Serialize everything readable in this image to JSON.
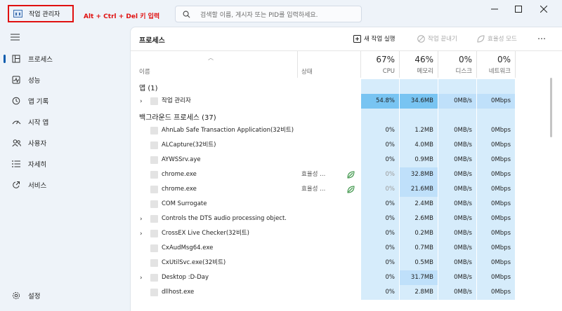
{
  "app": {
    "title": "작업 관리자",
    "annotation": "Alt + Ctrl + Del 키 입력",
    "search_placeholder": "검색할 이름, 게시자 또는 PID를 입력하세요."
  },
  "sidebar": {
    "items": [
      {
        "label": "프로세스",
        "icon": "processes-icon"
      },
      {
        "label": "성능",
        "icon": "performance-icon"
      },
      {
        "label": "앱 기록",
        "icon": "app-history-icon"
      },
      {
        "label": "시작 앱",
        "icon": "startup-apps-icon"
      },
      {
        "label": "사용자",
        "icon": "users-icon"
      },
      {
        "label": "자세히",
        "icon": "details-icon"
      },
      {
        "label": "서비스",
        "icon": "services-icon"
      }
    ],
    "settings_label": "설정"
  },
  "main": {
    "title": "프로세스",
    "commands": {
      "new_task": "새 작업 실행",
      "end_task": "작업 끝내기",
      "efficiency": "효율성 모드"
    },
    "columns": {
      "name": "이름",
      "status": "상태",
      "cpu": {
        "pct": "67%",
        "label": "CPU"
      },
      "mem": {
        "pct": "46%",
        "label": "메모리"
      },
      "disk": {
        "pct": "0%",
        "label": "디스크"
      },
      "net": {
        "pct": "0%",
        "label": "네트워크"
      }
    },
    "groups": {
      "apps": "앱 (1)",
      "background": "백그라운드 프로세스 (37)"
    },
    "app_rows": [
      {
        "name": "작업 관리자",
        "status": "",
        "cpu": "54.8%",
        "mem": "34.6MB",
        "disk": "0MB/s",
        "net": "0Mbps",
        "expand": true
      }
    ],
    "bg_rows": [
      {
        "name": "AhnLab Safe Transaction Application(32비트)",
        "status": "",
        "cpu": "0%",
        "mem": "1.2MB",
        "disk": "0MB/s",
        "net": "0Mbps",
        "expand": false
      },
      {
        "name": "ALCapture(32비트)",
        "status": "",
        "cpu": "0%",
        "mem": "4.0MB",
        "disk": "0MB/s",
        "net": "0Mbps",
        "expand": false
      },
      {
        "name": "AYWSSrv.aye",
        "status": "",
        "cpu": "0%",
        "mem": "0.9MB",
        "disk": "0MB/s",
        "net": "0Mbps",
        "expand": false
      },
      {
        "name": "chrome.exe",
        "status": "효율성 ...",
        "cpu": "0%",
        "mem": "32.8MB",
        "disk": "0MB/s",
        "net": "0Mbps",
        "expand": false,
        "efficiency": true
      },
      {
        "name": "chrome.exe",
        "status": "효율성 ...",
        "cpu": "0%",
        "mem": "21.6MB",
        "disk": "0MB/s",
        "net": "0Mbps",
        "expand": false,
        "efficiency": true
      },
      {
        "name": "COM Surrogate",
        "status": "",
        "cpu": "0%",
        "mem": "2.4MB",
        "disk": "0MB/s",
        "net": "0Mbps",
        "expand": false
      },
      {
        "name": "Controls the DTS audio processing object.",
        "status": "",
        "cpu": "0%",
        "mem": "2.6MB",
        "disk": "0MB/s",
        "net": "0Mbps",
        "expand": true
      },
      {
        "name": "CrossEX Live Checker(32비트)",
        "status": "",
        "cpu": "0%",
        "mem": "0.2MB",
        "disk": "0MB/s",
        "net": "0Mbps",
        "expand": true
      },
      {
        "name": "CxAudMsg64.exe",
        "status": "",
        "cpu": "0%",
        "mem": "0.7MB",
        "disk": "0MB/s",
        "net": "0Mbps",
        "expand": false
      },
      {
        "name": "CxUtilSvc.exe(32비트)",
        "status": "",
        "cpu": "0%",
        "mem": "0.5MB",
        "disk": "0MB/s",
        "net": "0Mbps",
        "expand": false
      },
      {
        "name": "Desktop :D-Day",
        "status": "",
        "cpu": "0%",
        "mem": "31.7MB",
        "disk": "0MB/s",
        "net": "0Mbps",
        "expand": true
      },
      {
        "name": "dllhost.exe",
        "status": "",
        "cpu": "0%",
        "mem": "2.8MB",
        "disk": "0MB/s",
        "net": "0Mbps",
        "expand": false
      }
    ]
  },
  "colors": {
    "heat_light": "#d6ecfb",
    "heat_mid": "#bfe0fa",
    "heat_strong": "#78c4f2",
    "accent": "#0b5cad",
    "annotation": "#e01010"
  }
}
